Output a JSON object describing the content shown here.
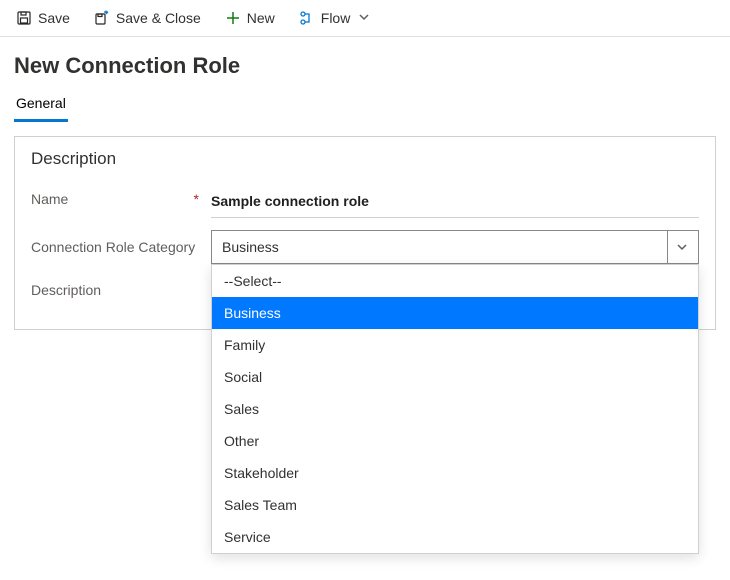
{
  "commandBar": {
    "save": "Save",
    "saveClose": "Save & Close",
    "new": "New",
    "flow": "Flow"
  },
  "page": {
    "title": "New Connection Role"
  },
  "tabs": {
    "general": "General"
  },
  "section": {
    "title": "Description",
    "nameLabel": "Name",
    "nameRequiredMark": "*",
    "nameValue": "Sample connection role",
    "categoryLabel": "Connection Role Category",
    "descriptionLabel": "Description",
    "descriptionValue": "---"
  },
  "dropdown": {
    "selected": "Business",
    "placeholder": "--Select--",
    "options": [
      "--Select--",
      "Business",
      "Family",
      "Social",
      "Sales",
      "Other",
      "Stakeholder",
      "Sales Team",
      "Service"
    ]
  }
}
